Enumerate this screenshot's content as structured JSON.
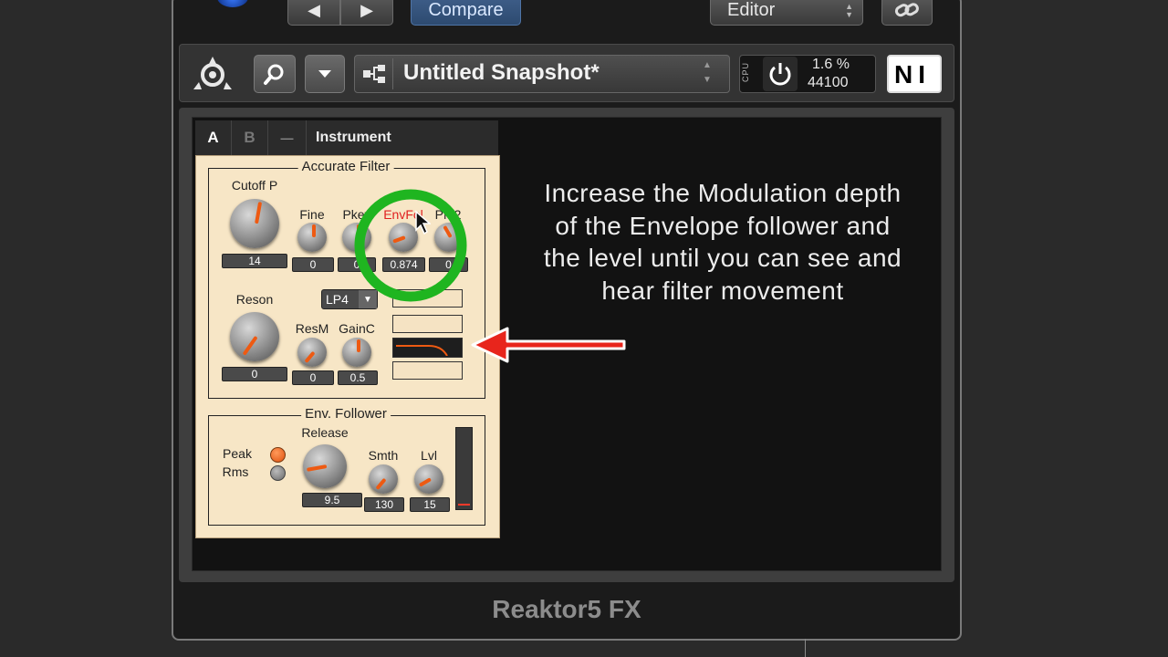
{
  "top": {
    "compare_label": "Compare",
    "editor_label": "Editor",
    "prev_icon": "◀",
    "next_icon": "▶"
  },
  "toolbar": {
    "snapshot_name": "Untitled Snapshot*",
    "cpu_label": "CPU",
    "cpu_percent": "1.6 %",
    "sample_rate": "44100",
    "ni_logo": "NI"
  },
  "tabs": {
    "a": "A",
    "b": "B",
    "dash": "—",
    "name": "Instrument"
  },
  "filter": {
    "title": "Accurate Filter",
    "cutoff": {
      "label": "Cutoff P",
      "value": "14"
    },
    "fine": {
      "label": "Fine",
      "value": "0"
    },
    "pkey": {
      "label": "Pkey",
      "value": "0"
    },
    "envfol": {
      "label": "EnvFol",
      "value": "0.874"
    },
    "pm2": {
      "label": "PM2",
      "value": "0"
    },
    "mode": "LP4",
    "reson": {
      "label": "Reson",
      "value": "0"
    },
    "resm": {
      "label": "ResM",
      "value": "0"
    },
    "gainc": {
      "label": "GainC",
      "value": "0.5"
    }
  },
  "env": {
    "title": "Env. Follower",
    "release": {
      "label": "Release",
      "value": "9.5"
    },
    "peak_label": "Peak",
    "rms_label": "Rms",
    "smth": {
      "label": "Smth",
      "value": "130"
    },
    "lvl": {
      "label": "Lvl",
      "value": "15"
    }
  },
  "instruction": "Increase the Modulation depth of the Envelope follower and the level until you can see and hear filter movement",
  "footer": "Reaktor5 FX",
  "colors": {
    "accent_orange": "#ee5a12",
    "highlight_green": "#1fb520",
    "arrow_red": "#e8251c",
    "panel_cream": "#f7e6c6"
  }
}
